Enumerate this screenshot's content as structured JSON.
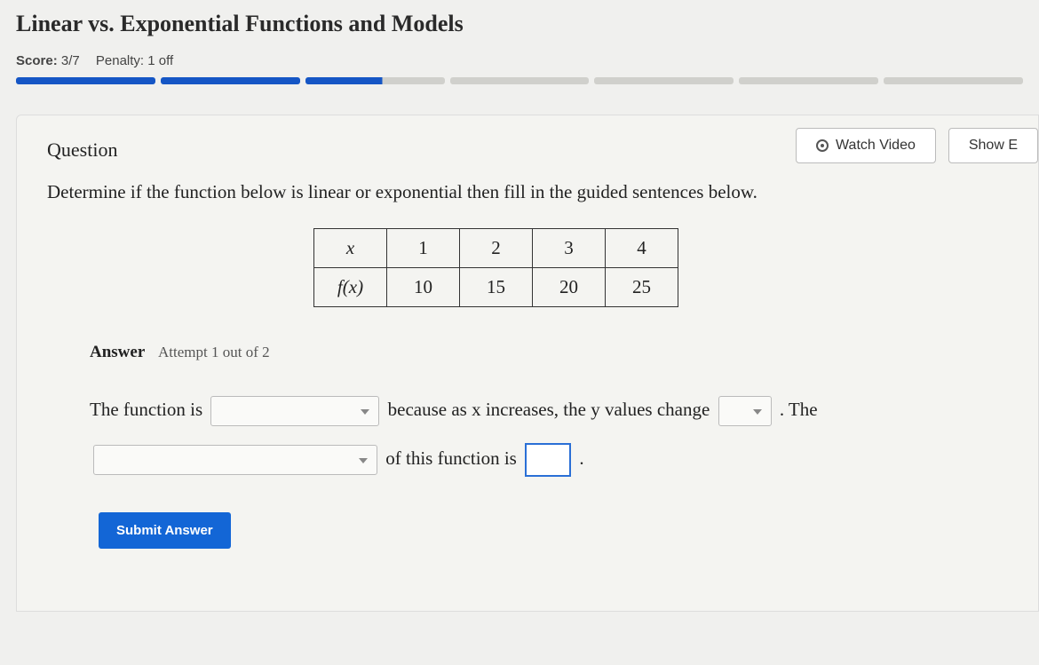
{
  "title": "Linear vs. Exponential Functions and Models",
  "score": {
    "label": "Score:",
    "value": "3/7",
    "penalty_label": "Penalty:",
    "penalty_value": "1 off"
  },
  "progress_segments": 7,
  "progress_filled": 3,
  "actions": {
    "watch_video": "Watch Video",
    "show_examples": "Show E"
  },
  "question_heading": "Question",
  "prompt": "Determine if the function below is linear or exponential then fill in the guided sentences below.",
  "table": {
    "row1": [
      "x",
      "1",
      "2",
      "3",
      "4"
    ],
    "row2": [
      "f(x)",
      "10",
      "15",
      "20",
      "25"
    ]
  },
  "answer": {
    "label": "Answer",
    "attempt": "Attempt 1 out of 2"
  },
  "sentence": {
    "part1": "The function is",
    "part2": "because as x increases, the y values change",
    "part3": ". The",
    "part4": "of this function is",
    "part5": "."
  },
  "submit_label": "Submit Answer"
}
